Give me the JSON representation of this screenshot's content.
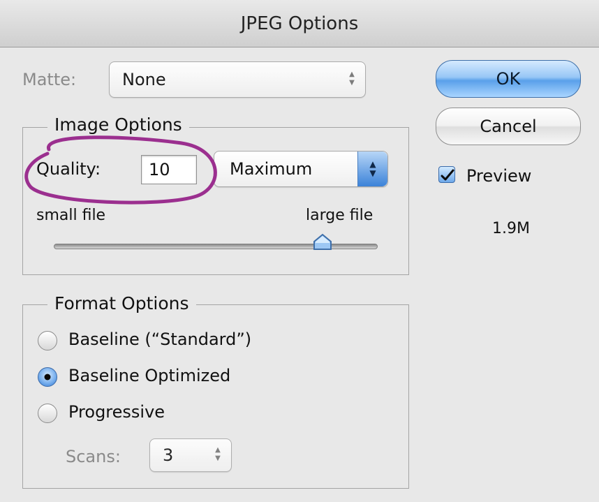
{
  "window": {
    "title": "JPEG Options"
  },
  "matte": {
    "label": "Matte:",
    "value": "None"
  },
  "image_options": {
    "title": "Image Options",
    "quality_label": "Quality:",
    "quality_value": "10",
    "quality_preset": "Maximum",
    "slider_left_label": "small file",
    "slider_right_label": "large file",
    "slider_level_fraction": 0.83
  },
  "format_options": {
    "title": "Format Options",
    "options": [
      "Baseline (“Standard”)",
      "Baseline Optimized",
      "Progressive"
    ],
    "selected_index": 1,
    "scans_label": "Scans:",
    "scans_value": "3"
  },
  "buttons": {
    "ok": "OK",
    "cancel": "Cancel"
  },
  "preview": {
    "label": "Preview",
    "checked": true,
    "file_size": "1.9M"
  },
  "annotation": {
    "color": "#9b2f8f"
  }
}
